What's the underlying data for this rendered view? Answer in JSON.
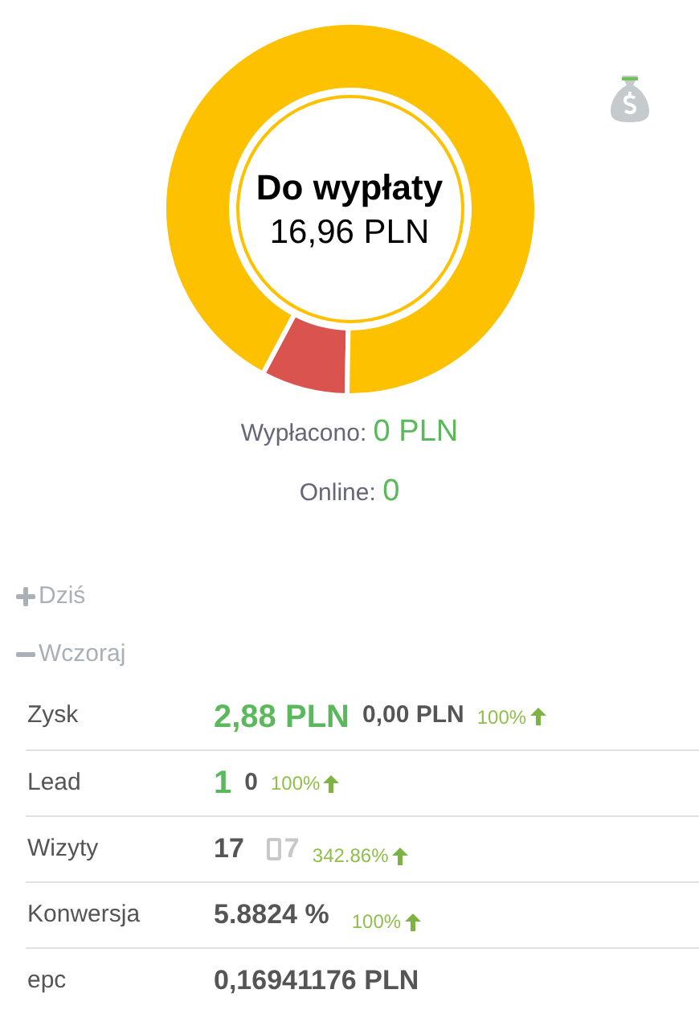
{
  "summary": {
    "title": "Do wypłaty",
    "amount": "16,96 PLN"
  },
  "paid": {
    "label": "Wypłacono:",
    "value": "0 PLN"
  },
  "online": {
    "label": "Online:",
    "value": "0"
  },
  "sections": [
    {
      "label": "Dziś",
      "expanded": false
    },
    {
      "label": "Wczoraj",
      "expanded": true
    }
  ],
  "rows": [
    {
      "label": "Zysk",
      "cells": [
        {
          "kind": "main-green",
          "text": "2,88 PLN"
        },
        {
          "kind": "previous",
          "text": "0,00 PLN"
        },
        {
          "kind": "change",
          "text": "100%"
        }
      ]
    },
    {
      "label": "Lead",
      "cells": [
        {
          "kind": "main-green",
          "text": "1"
        },
        {
          "kind": "previous",
          "text": "0"
        },
        {
          "kind": "change",
          "text": "100%"
        }
      ]
    },
    {
      "label": "Wizyty",
      "cells": [
        {
          "kind": "main",
          "text": "17"
        },
        {
          "kind": "mobile",
          "text": "7"
        },
        {
          "kind": "change-low",
          "text": "342.86%"
        }
      ]
    },
    {
      "label": "Konwersja",
      "cells": [
        {
          "kind": "main",
          "text": "5.8824 %"
        },
        {
          "kind": "change-low",
          "text": "100%"
        }
      ]
    },
    {
      "label": "epc",
      "cells": [
        {
          "kind": "main",
          "text": "0,16941176 PLN"
        }
      ]
    }
  ]
}
